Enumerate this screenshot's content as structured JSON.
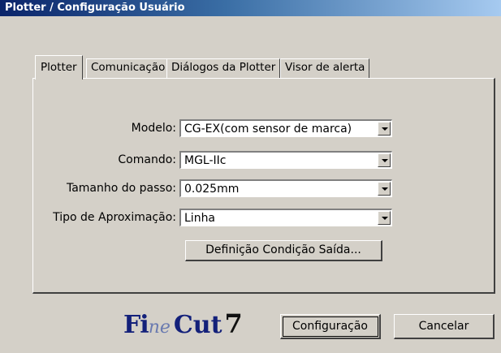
{
  "window": {
    "title": "Plotter / Configuração Usuário"
  },
  "tabs": [
    {
      "label": "Plotter",
      "active": true
    },
    {
      "label": "Comunicação",
      "active": false
    },
    {
      "label": "Diálogos da Plotter",
      "active": false
    },
    {
      "label": "Visor de alerta",
      "active": false
    }
  ],
  "form": {
    "modelo": {
      "label": "Modelo:",
      "value": "CG-EX(com sensor de marca)"
    },
    "comando": {
      "label": "Comando:",
      "value": "MGL-IIc"
    },
    "passo": {
      "label": "Tamanho do passo:",
      "value": "0.025mm"
    },
    "aproximacao": {
      "label": "Tipo de Aproximação:",
      "value": "Linha"
    }
  },
  "buttons": {
    "output_condition": "Definição Condição Saída...",
    "ok": "Configuração",
    "cancel": "Cancelar"
  },
  "logo": {
    "part1": "Fi",
    "part2": "ne",
    "part3": "Cut",
    "part4": "7"
  }
}
